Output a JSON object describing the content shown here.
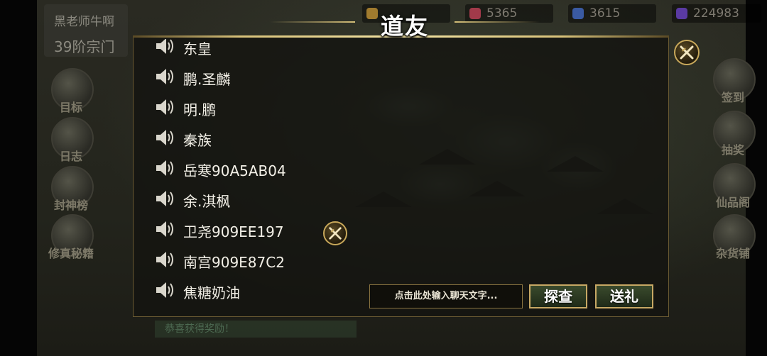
{
  "resources": [
    {
      "value": "",
      "color": "#a07b2e"
    },
    {
      "value": "5365",
      "color": "#a23a4a"
    },
    {
      "value": "3615",
      "color": "#3a5aa2"
    },
    {
      "value": "224983",
      "color": "#5a3aa2"
    }
  ],
  "player": {
    "name": "黑老师牛啊",
    "sect": "39阶宗门"
  },
  "side_left": [
    "目标",
    "日志",
    "封神榜",
    "修真秘籍"
  ],
  "side_right": [
    "签到",
    "抽奖",
    "仙品阁",
    "杂货铺"
  ],
  "bottom_strip": "恭喜获得奖励！",
  "panel": {
    "title": "道友",
    "friends": [
      "东皇",
      "鹏.圣麟",
      "明.鹏",
      "秦族",
      "岳寒90A5AB04",
      "余.淇枫",
      "卫尧909EE197",
      "南宫909E87C2",
      "焦糖奶油"
    ],
    "chat_placeholder": "点击此处输入聊天文字...",
    "inspect_button": "探查",
    "gift_button": "送礼"
  },
  "colors": {
    "accent_gold": "#d8c27a",
    "panel_bg": "#141410",
    "button_border": "#c7a864"
  },
  "icons": {
    "friend": "speaker-signal-icon",
    "close": "crossed-swords-close-icon"
  }
}
